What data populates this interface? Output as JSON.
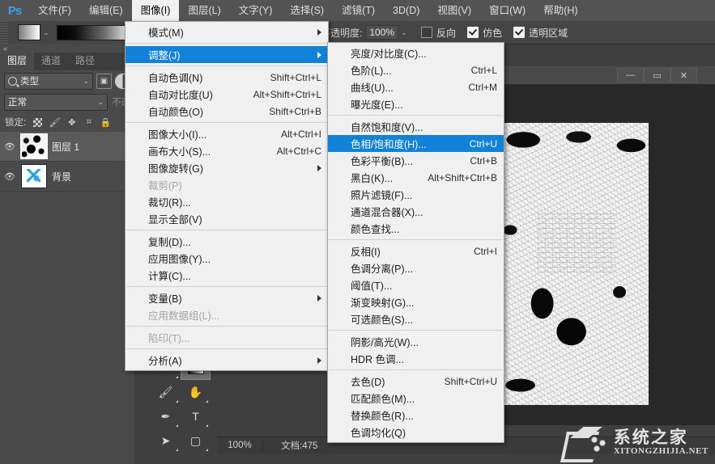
{
  "app": {
    "logo": "Ps"
  },
  "menubar": {
    "items": [
      {
        "label": "文件(F)",
        "active": false
      },
      {
        "label": "编辑(E)",
        "active": false
      },
      {
        "label": "图像(I)",
        "active": true
      },
      {
        "label": "图层(L)",
        "active": false
      },
      {
        "label": "文字(Y)",
        "active": false
      },
      {
        "label": "选择(S)",
        "active": false
      },
      {
        "label": "滤镜(T)",
        "active": false
      },
      {
        "label": "3D(D)",
        "active": false
      },
      {
        "label": "视图(V)",
        "active": false
      },
      {
        "label": "窗口(W)",
        "active": false
      },
      {
        "label": "帮助(H)",
        "active": false
      }
    ]
  },
  "options_bar": {
    "opacity_label": "不透明度:",
    "opacity_value": "100%",
    "reverse_label": "反向",
    "reverse_checked": false,
    "dither_label": "仿色",
    "dither_checked": true,
    "transparency_label": "透明区域",
    "transparency_checked": true
  },
  "layers_panel": {
    "tabs": [
      {
        "label": "图层",
        "selected": true
      },
      {
        "label": "通道",
        "selected": false
      },
      {
        "label": "路径",
        "selected": false
      }
    ],
    "filter_value": "类型",
    "blend_mode": "正常",
    "opacity_label": "不透",
    "lock_label": "锁定:",
    "layers": [
      {
        "name": "图层 1",
        "selected": true,
        "visible": true
      },
      {
        "name": "背景",
        "selected": false,
        "visible": true
      }
    ]
  },
  "menu_image": {
    "title": "图像",
    "items": [
      {
        "label": "模式(M)",
        "shortcut": "",
        "submenu": true,
        "sep_after": true
      },
      {
        "label": "调整(J)",
        "shortcut": "",
        "submenu": true,
        "highlight": true,
        "sep_after": true
      },
      {
        "label": "自动色调(N)",
        "shortcut": "Shift+Ctrl+L"
      },
      {
        "label": "自动对比度(U)",
        "shortcut": "Alt+Shift+Ctrl+L"
      },
      {
        "label": "自动颜色(O)",
        "shortcut": "Shift+Ctrl+B",
        "sep_after": true
      },
      {
        "label": "图像大小(I)...",
        "shortcut": "Alt+Ctrl+I"
      },
      {
        "label": "画布大小(S)...",
        "shortcut": "Alt+Ctrl+C"
      },
      {
        "label": "图像旋转(G)",
        "shortcut": "",
        "submenu": true
      },
      {
        "label": "裁剪(P)",
        "shortcut": "",
        "disabled": true
      },
      {
        "label": "裁切(R)...",
        "shortcut": ""
      },
      {
        "label": "显示全部(V)",
        "shortcut": "",
        "sep_after": true
      },
      {
        "label": "复制(D)...",
        "shortcut": ""
      },
      {
        "label": "应用图像(Y)...",
        "shortcut": ""
      },
      {
        "label": "计算(C)...",
        "shortcut": "",
        "sep_after": true
      },
      {
        "label": "变量(B)",
        "shortcut": "",
        "submenu": true
      },
      {
        "label": "应用数据组(L)...",
        "shortcut": "",
        "disabled": true,
        "sep_after": true
      },
      {
        "label": "陷印(T)...",
        "shortcut": "",
        "disabled": true,
        "sep_after": true
      },
      {
        "label": "分析(A)",
        "shortcut": "",
        "submenu": true
      }
    ]
  },
  "menu_adjust": {
    "title": "调整",
    "items": [
      {
        "label": "亮度/对比度(C)...",
        "shortcut": ""
      },
      {
        "label": "色阶(L)...",
        "shortcut": "Ctrl+L"
      },
      {
        "label": "曲线(U)...",
        "shortcut": "Ctrl+M"
      },
      {
        "label": "曝光度(E)...",
        "shortcut": "",
        "sep_after": true
      },
      {
        "label": "自然饱和度(V)...",
        "shortcut": ""
      },
      {
        "label": "色相/饱和度(H)...",
        "shortcut": "Ctrl+U",
        "highlight": true
      },
      {
        "label": "色彩平衡(B)...",
        "shortcut": "Ctrl+B"
      },
      {
        "label": "黑白(K)...",
        "shortcut": "Alt+Shift+Ctrl+B"
      },
      {
        "label": "照片滤镜(F)...",
        "shortcut": ""
      },
      {
        "label": "通道混合器(X)...",
        "shortcut": ""
      },
      {
        "label": "颜色查找...",
        "shortcut": "",
        "sep_after": true
      },
      {
        "label": "反相(I)",
        "shortcut": "Ctrl+I"
      },
      {
        "label": "色调分离(P)...",
        "shortcut": ""
      },
      {
        "label": "阈值(T)...",
        "shortcut": ""
      },
      {
        "label": "渐变映射(G)...",
        "shortcut": ""
      },
      {
        "label": "可选颜色(S)...",
        "shortcut": "",
        "sep_after": true
      },
      {
        "label": "阴影/高光(W)...",
        "shortcut": ""
      },
      {
        "label": "HDR 色调...",
        "shortcut": "",
        "sep_after": true
      },
      {
        "label": "去色(D)",
        "shortcut": "Shift+Ctrl+U"
      },
      {
        "label": "匹配颜色(M)...",
        "shortcut": ""
      },
      {
        "label": "替换颜色(R)...",
        "shortcut": ""
      },
      {
        "label": "色调均化(Q)",
        "shortcut": ""
      }
    ]
  },
  "toolbar": {
    "tools": [
      {
        "name": "blur-tool",
        "glyph": "◗"
      },
      {
        "name": "dodge-tool",
        "glyph": "⬭"
      },
      {
        "name": "pen-tool",
        "glyph": "✒"
      },
      {
        "name": "type-tool",
        "glyph": "T"
      },
      {
        "name": "path-selection-tool",
        "glyph": "➤"
      },
      {
        "name": "rectangle-tool",
        "glyph": "▢"
      }
    ]
  },
  "document_window": {
    "minimize": "—",
    "maximize": "▭",
    "close": "✕"
  },
  "status_bar": {
    "zoom": "100%",
    "doc_info": "文档:475"
  },
  "watermark": {
    "cn": "系统之家",
    "en": "XITONGZHIJIA.NET"
  }
}
